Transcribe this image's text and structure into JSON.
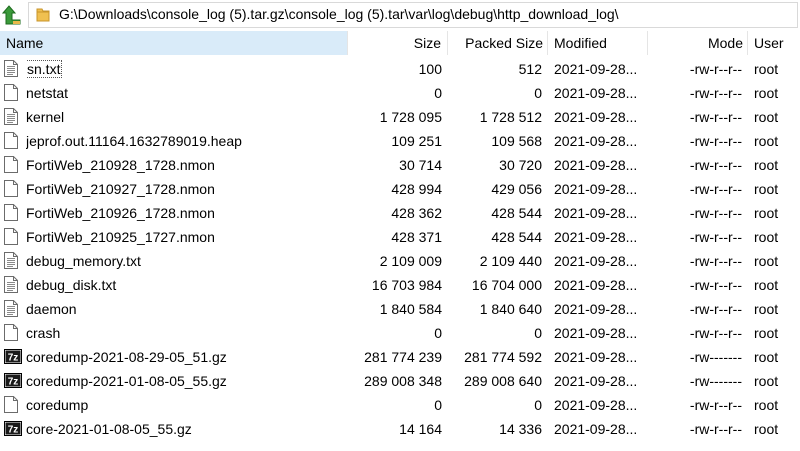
{
  "address": {
    "path": "G:\\Downloads\\console_log (5).tar.gz\\console_log (5).tar\\var\\log\\debug\\http_download_log\\"
  },
  "columns": {
    "name": "Name",
    "size": "Size",
    "packed": "Packed Size",
    "modified": "Modified",
    "mode": "Mode",
    "user": "User"
  },
  "files": [
    {
      "name": "sn.txt",
      "size": "100",
      "packed": "512",
      "modified": "2021-09-28...",
      "mode": "-rw-r--r--",
      "user": "root",
      "icon": "text-file-icon"
    },
    {
      "name": "netstat",
      "size": "0",
      "packed": "0",
      "modified": "2021-09-28...",
      "mode": "-rw-r--r--",
      "user": "root",
      "icon": "blank-file-icon"
    },
    {
      "name": "kernel",
      "size": "1 728 095",
      "packed": "1 728 512",
      "modified": "2021-09-28...",
      "mode": "-rw-r--r--",
      "user": "root",
      "icon": "text-file-icon"
    },
    {
      "name": "jeprof.out.11164.1632789019.heap",
      "size": "109 251",
      "packed": "109 568",
      "modified": "2021-09-28...",
      "mode": "-rw-r--r--",
      "user": "root",
      "icon": "blank-file-icon"
    },
    {
      "name": "FortiWeb_210928_1728.nmon",
      "size": "30 714",
      "packed": "30 720",
      "modified": "2021-09-28...",
      "mode": "-rw-r--r--",
      "user": "root",
      "icon": "blank-file-icon"
    },
    {
      "name": "FortiWeb_210927_1728.nmon",
      "size": "428 994",
      "packed": "429 056",
      "modified": "2021-09-28...",
      "mode": "-rw-r--r--",
      "user": "root",
      "icon": "blank-file-icon"
    },
    {
      "name": "FortiWeb_210926_1728.nmon",
      "size": "428 362",
      "packed": "428 544",
      "modified": "2021-09-28...",
      "mode": "-rw-r--r--",
      "user": "root",
      "icon": "blank-file-icon"
    },
    {
      "name": "FortiWeb_210925_1727.nmon",
      "size": "428 371",
      "packed": "428 544",
      "modified": "2021-09-28...",
      "mode": "-rw-r--r--",
      "user": "root",
      "icon": "blank-file-icon"
    },
    {
      "name": "debug_memory.txt",
      "size": "2 109 009",
      "packed": "2 109 440",
      "modified": "2021-09-28...",
      "mode": "-rw-r--r--",
      "user": "root",
      "icon": "text-file-icon"
    },
    {
      "name": "debug_disk.txt",
      "size": "16 703 984",
      "packed": "16 704 000",
      "modified": "2021-09-28...",
      "mode": "-rw-r--r--",
      "user": "root",
      "icon": "text-file-icon"
    },
    {
      "name": "daemon",
      "size": "1 840 584",
      "packed": "1 840 640",
      "modified": "2021-09-28...",
      "mode": "-rw-r--r--",
      "user": "root",
      "icon": "text-file-icon"
    },
    {
      "name": "crash",
      "size": "0",
      "packed": "0",
      "modified": "2021-09-28...",
      "mode": "-rw-r--r--",
      "user": "root",
      "icon": "blank-file-icon"
    },
    {
      "name": "coredump-2021-08-29-05_51.gz",
      "size": "281 774 239",
      "packed": "281 774 592",
      "modified": "2021-09-28...",
      "mode": "-rw-------",
      "user": "root",
      "icon": "7z-archive-icon"
    },
    {
      "name": "coredump-2021-01-08-05_55.gz",
      "size": "289 008 348",
      "packed": "289 008 640",
      "modified": "2021-09-28...",
      "mode": "-rw-------",
      "user": "root",
      "icon": "7z-archive-icon"
    },
    {
      "name": "coredump",
      "size": "0",
      "packed": "0",
      "modified": "2021-09-28...",
      "mode": "-rw-r--r--",
      "user": "root",
      "icon": "blank-file-icon"
    },
    {
      "name": "core-2021-01-08-05_55.gz",
      "size": "14 164",
      "packed": "14 336",
      "modified": "2021-09-28...",
      "mode": "-rw-r--r--",
      "user": "root",
      "icon": "7z-archive-icon"
    }
  ],
  "colors": {
    "header_selected": "#d9ebf9",
    "folder": "#e8b84a",
    "up_arrow": "#3a9a3a"
  }
}
